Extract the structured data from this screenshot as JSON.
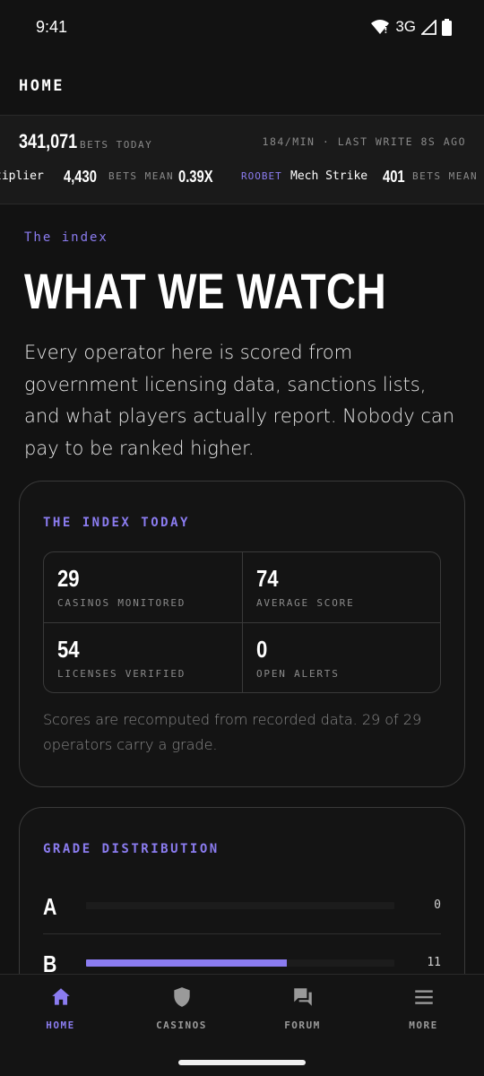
{
  "status_bar": {
    "time": "9:41",
    "network": "3G"
  },
  "header": {
    "title": "HOME"
  },
  "ticker": {
    "bets_today": "341,071",
    "bets_today_label": "BETS TODAY",
    "rate": "184/MIN",
    "separator": "·",
    "last_write": "LAST WRITE 8S AGO",
    "row": {
      "game_1_fragment": "tiplier",
      "game_1_count": "4,430",
      "game_1_label": "BETS MEAN",
      "game_1_mean": "0.39X",
      "game_2_brand": "ROOBET",
      "game_2_name": "Mech Strike",
      "game_2_count": "401",
      "game_2_label": "BETS MEAN"
    }
  },
  "main": {
    "eyebrow": "The index",
    "title": "WHAT WE WATCH",
    "intro": "Every operator here is scored from government licensing data, sanctions lists, and what players actually report. Nobody can pay to be ranked higher."
  },
  "index_card": {
    "title": "THE INDEX TODAY",
    "stats": [
      {
        "value": "29",
        "label": "CASINOS MONITORED"
      },
      {
        "value": "74",
        "label": "AVERAGE SCORE"
      },
      {
        "value": "54",
        "label": "LICENSES VERIFIED"
      },
      {
        "value": "0",
        "label": "OPEN ALERTS"
      }
    ],
    "note": "Scores are recomputed from recorded data. 29 of 29 operators carry a grade."
  },
  "grade_card": {
    "title": "GRADE DISTRIBUTION",
    "grades": [
      {
        "letter": "A",
        "count": "0",
        "fraction": 0
      },
      {
        "letter": "B",
        "count": "11",
        "fraction": 0.65
      }
    ]
  },
  "nav": {
    "items": [
      {
        "label": "HOME",
        "icon": "home-icon",
        "active": true
      },
      {
        "label": "CASINOS",
        "icon": "shield-icon",
        "active": false
      },
      {
        "label": "FORUM",
        "icon": "forum-icon",
        "active": false
      },
      {
        "label": "MORE",
        "icon": "menu-icon",
        "active": false
      }
    ]
  },
  "colors": {
    "accent": "#8b7cf0",
    "background": "#121212",
    "muted": "#8a8a8a"
  }
}
